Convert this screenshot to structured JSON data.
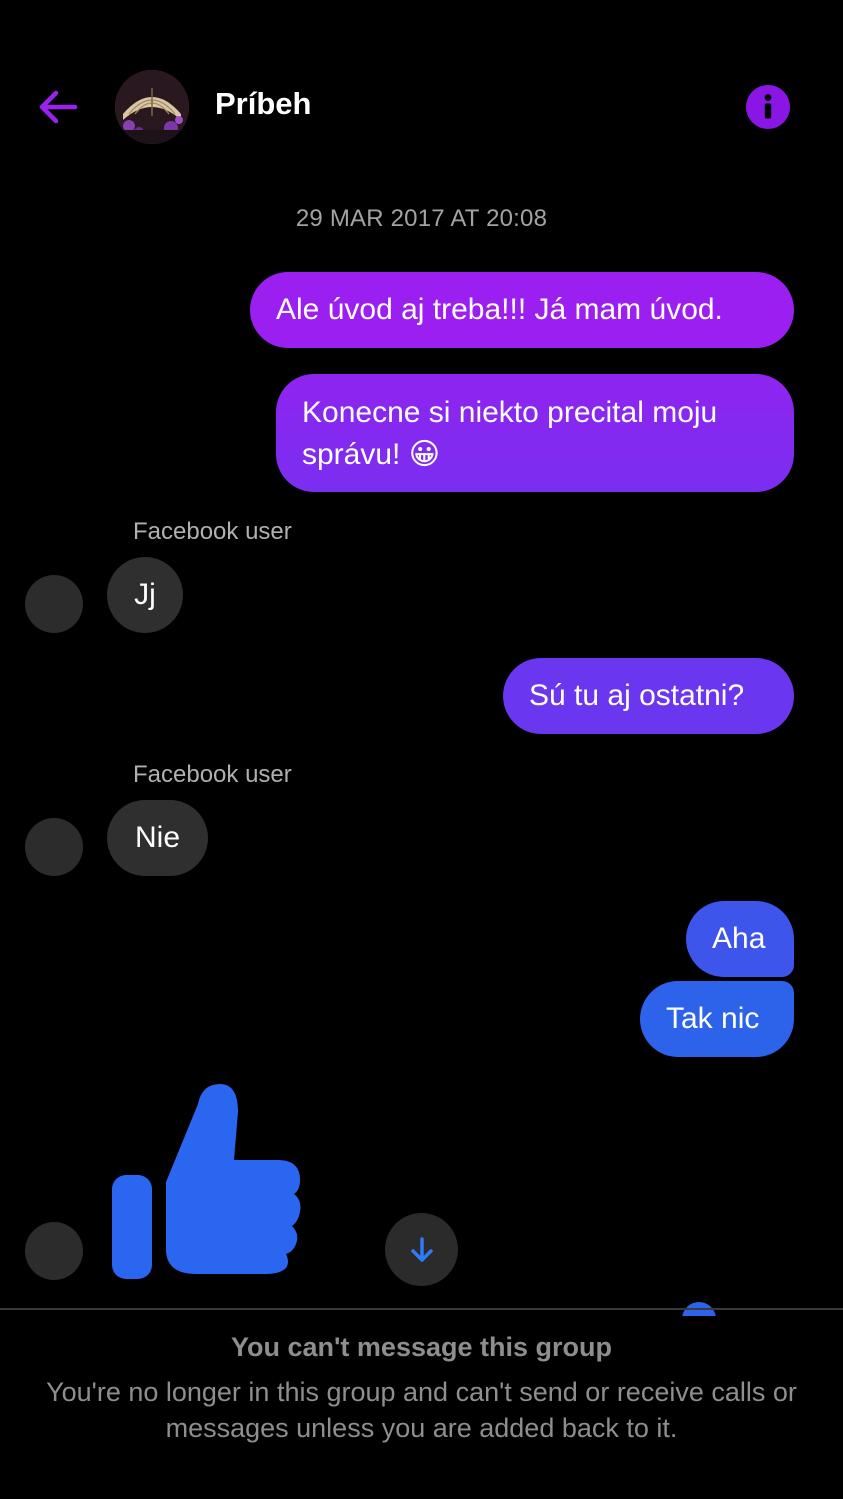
{
  "header": {
    "title": "Príbeh",
    "back_icon": "arrow-left-icon",
    "info_icon": "info-icon",
    "accent_color": "#8a16e6"
  },
  "conversation": {
    "timestamp": "29 MAR 2017 AT 20:08",
    "messages": [
      {
        "direction": "outgoing",
        "text": "Ale úvod aj treba!!! Já mam úvod."
      },
      {
        "direction": "outgoing",
        "text": "Konecne si niekto precital moju správu! 😀"
      },
      {
        "direction": "incoming",
        "sender": "Facebook user",
        "text": "Jj"
      },
      {
        "direction": "outgoing",
        "text": "Sú tu aj ostatni?"
      },
      {
        "direction": "incoming",
        "sender": "Facebook user",
        "text": "Nie"
      },
      {
        "direction": "outgoing",
        "text": "Aha"
      },
      {
        "direction": "outgoing",
        "text": "Tak nic"
      },
      {
        "direction": "incoming",
        "type": "like",
        "icon": "thumbs-up-icon"
      }
    ]
  },
  "scroll_down_icon": "arrow-down-icon",
  "notice": {
    "title": "You can't message this group",
    "body": "You're no longer in this group and can't send or receive calls or messages unless you are added back to it."
  }
}
